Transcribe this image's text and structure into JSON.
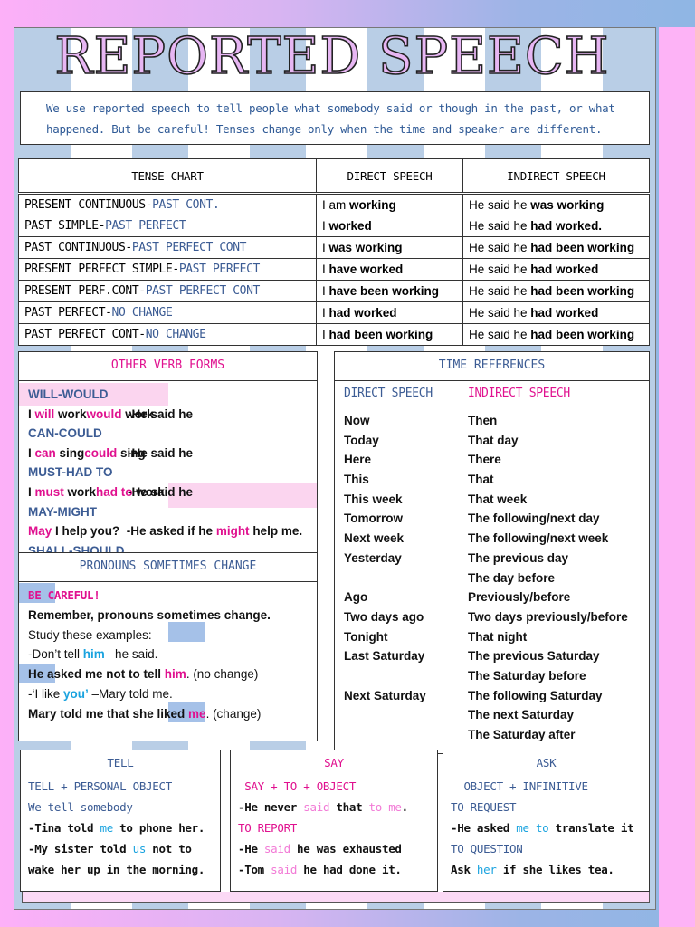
{
  "title": "REPORTED SPEECH",
  "intro": [
    "We use reported speech to tell people what somebody said or though in the past, or what",
    "happened. But be careful! Tenses change only when the time and speaker are different."
  ],
  "tense_chart": {
    "headers": [
      "TENSE CHART",
      "DIRECT SPEECH",
      "INDIRECT SPEECH"
    ],
    "rows": [
      {
        "tense": "PRESENT CONTINUOUS-",
        "change": "PAST CONT.",
        "direct_a": "I am ",
        "direct_b": "working",
        "indirect_a": "He said he ",
        "indirect_b": "was working"
      },
      {
        "tense": "PAST SIMPLE-",
        "change": "PAST PERFECT",
        "direct_a": "I ",
        "direct_b": "worked",
        "indirect_a": "He said he ",
        "indirect_b": "had worked."
      },
      {
        "tense": "PAST CONTINUOUS-",
        "change": "PAST PERFECT CONT",
        "direct_a": "I ",
        "direct_b": "was working",
        "indirect_a": "He said he ",
        "indirect_b": "had been working"
      },
      {
        "tense": "PRESENT PERFECT SIMPLE-",
        "change": "PAST PERFECT",
        "direct_a": "I ",
        "direct_b": "have worked",
        "indirect_a": "He said he ",
        "indirect_b": "had worked"
      },
      {
        "tense": "PRESENT PERF.CONT-",
        "change": "PAST PERFECT CONT",
        "direct_a": "I ",
        "direct_b": "have been working",
        "indirect_a": "He said he ",
        "indirect_b": "had been working"
      },
      {
        "tense": "PAST PERFECT-",
        "change": "NO CHANGE",
        "direct_a": "I ",
        "direct_b": "had worked",
        "indirect_a": "He said he ",
        "indirect_b": "had worked"
      },
      {
        "tense": "PAST PERFECT CONT-",
        "change": "NO CHANGE",
        "direct_a": "I ",
        "direct_b": "had been working",
        "indirect_a": "He said he ",
        "indirect_b": "had been working"
      }
    ]
  },
  "verb_forms": {
    "title": "OTHER VERB FORMS",
    "lines": [
      [
        {
          "t": "WILL-WOULD",
          "c": "b"
        }
      ],
      [
        {
          "t": "I ",
          "c": "k"
        },
        {
          "t": "will",
          "c": "p"
        },
        {
          "t": " work",
          "c": "k"
        },
        {
          "t": "-He said he ",
          "c": "k",
          "tab": true
        },
        {
          "t": "would",
          "c": "p"
        },
        {
          "t": " work",
          "c": "k"
        }
      ],
      [
        {
          "t": "CAN-COULD",
          "c": "b"
        }
      ],
      [
        {
          "t": "I ",
          "c": "k"
        },
        {
          "t": "can",
          "c": "p"
        },
        {
          "t": " sing",
          "c": "k"
        },
        {
          "t": "-He said he ",
          "c": "k",
          "tab": true
        },
        {
          "t": "could",
          "c": "p"
        },
        {
          "t": " sing",
          "c": "k"
        }
      ],
      [
        {
          "t": "MUST-HAD TO",
          "c": "b"
        }
      ],
      [
        {
          "t": "I ",
          "c": "k"
        },
        {
          "t": "must",
          "c": "p"
        },
        {
          "t": " work",
          "c": "k"
        },
        {
          "t": "-He said he ",
          "c": "k",
          "tab": true
        },
        {
          "t": "had to",
          "c": "p"
        },
        {
          "t": " work",
          "c": "k"
        }
      ],
      [
        {
          "t": "MAY-MIGHT",
          "c": "b"
        }
      ],
      [
        {
          "t": "May",
          "c": "p"
        },
        {
          "t": " I help you?  -He asked if he ",
          "c": "k"
        },
        {
          "t": "might",
          "c": "p"
        },
        {
          "t": " help me.",
          "c": "k"
        }
      ],
      [
        {
          "t": "SHALL-SHOULD",
          "c": "b"
        }
      ]
    ]
  },
  "pronouns": {
    "title": "PRONOUNS SOMETIMES CHANGE",
    "lines": [
      [
        {
          "t": "BE CAREFUL!",
          "c": "p",
          "m": true
        }
      ],
      [
        {
          "t": "Remember, pronouns sometimes change.",
          "c": "k"
        }
      ],
      [
        {
          "t": "Study these examples:",
          "c": "k n"
        }
      ],
      [
        {
          "t": "-Don’t tell ",
          "c": "k n"
        },
        {
          "t": "him",
          "c": "c"
        },
        {
          "t": " –he said.",
          "c": "k n"
        }
      ],
      [
        {
          "t": "He asked me not to tell ",
          "c": "k"
        },
        {
          "t": "him",
          "c": "p"
        },
        {
          "t": ". (no change)",
          "c": "k n"
        }
      ],
      [
        {
          "t": "-‘I like ",
          "c": "k n"
        },
        {
          "t": "you’",
          "c": "c"
        },
        {
          "t": " –Mary told me.",
          "c": "k n"
        }
      ],
      [
        {
          "t": "Mary told me that she liked ",
          "c": "k"
        },
        {
          "t": "me",
          "c": "p"
        },
        {
          "t": ". (change)",
          "c": "k n"
        }
      ]
    ]
  },
  "time_references": {
    "title": "TIME REFERENCES",
    "direct_header": "DIRECT SPEECH",
    "indirect_header": "INDIRECT SPEECH",
    "rows": [
      [
        "Now",
        "Then"
      ],
      [
        "Today",
        "That day"
      ],
      [
        "Here",
        "There"
      ],
      [
        "This",
        "That"
      ],
      [
        "This week",
        "That week"
      ],
      [
        "Tomorrow",
        "The following/next day"
      ],
      [
        "Next week",
        "The following/next week"
      ],
      [
        "Yesterday",
        "The previous day"
      ],
      [
        "",
        "The day before"
      ],
      [
        "Ago",
        "Previously/before"
      ],
      [
        "Two days ago",
        "Two days previously/before"
      ],
      [
        "Tonight",
        "That night"
      ],
      [
        "Last Saturday",
        "The previous Saturday"
      ],
      [
        "",
        "The Saturday before"
      ],
      [
        "Next Saturday",
        "The following Saturday"
      ],
      [
        "",
        "The next Saturday"
      ],
      [
        "",
        "The Saturday after"
      ]
    ]
  },
  "tell": {
    "title": "TELL",
    "lines": [
      [
        {
          "t": "TELL + PERSONAL OBJECT",
          "c": "b n"
        }
      ],
      [
        {
          "t": "We tell somebody",
          "c": "b n"
        }
      ],
      [
        {
          "t": "-Tina told ",
          "c": "k"
        },
        {
          "t": "me",
          "c": "c n"
        },
        {
          "t": " to phone her.",
          "c": "k"
        }
      ],
      [
        {
          "t": "-My sister told ",
          "c": "k"
        },
        {
          "t": "us",
          "c": "c n"
        },
        {
          "t": " not to",
          "c": "k"
        }
      ],
      [
        {
          "t": "wake her up in the morning.",
          "c": "k"
        }
      ]
    ]
  },
  "say": {
    "title": "SAY",
    "lines": [
      [
        {
          "t": " SAY + TO + OBJECT",
          "c": "p n"
        }
      ],
      [
        {
          "t": "-He never ",
          "c": "k"
        },
        {
          "t": "said",
          "c": "lp n"
        },
        {
          "t": " that ",
          "c": "k"
        },
        {
          "t": "to me",
          "c": "lp n"
        },
        {
          "t": ".",
          "c": "k"
        }
      ],
      [
        {
          "t": "TO REPORT",
          "c": "p n"
        }
      ],
      [
        {
          "t": "-He ",
          "c": "k"
        },
        {
          "t": "said",
          "c": "lp n"
        },
        {
          "t": " he was exhausted",
          "c": "k"
        }
      ],
      [
        {
          "t": "-Tom ",
          "c": "k"
        },
        {
          "t": "said",
          "c": "lp n"
        },
        {
          "t": " he had done it.",
          "c": "k"
        }
      ]
    ]
  },
  "ask": {
    "title": "ASK",
    "lines": [
      [
        {
          "t": "  OBJECT + INFINITIVE",
          "c": "b n"
        }
      ],
      [
        {
          "t": "TO REQUEST",
          "c": "b n"
        }
      ],
      [
        {
          "t": "-He asked ",
          "c": "k"
        },
        {
          "t": "me to",
          "c": "c n"
        },
        {
          "t": " translate it",
          "c": "k"
        }
      ],
      [
        {
          "t": "TO QUESTION",
          "c": "b n"
        }
      ],
      [
        {
          "t": "Ask ",
          "c": "k"
        },
        {
          "t": "her",
          "c": "c n"
        },
        {
          "t": " if she likes tea.",
          "c": "k"
        }
      ]
    ]
  },
  "colors": {
    "blue": "#3c5c94",
    "pink": "#e0118f",
    "cyan": "#1aa3df",
    "light_pink": "#f27ad6",
    "stripe": "#b9cee6"
  }
}
